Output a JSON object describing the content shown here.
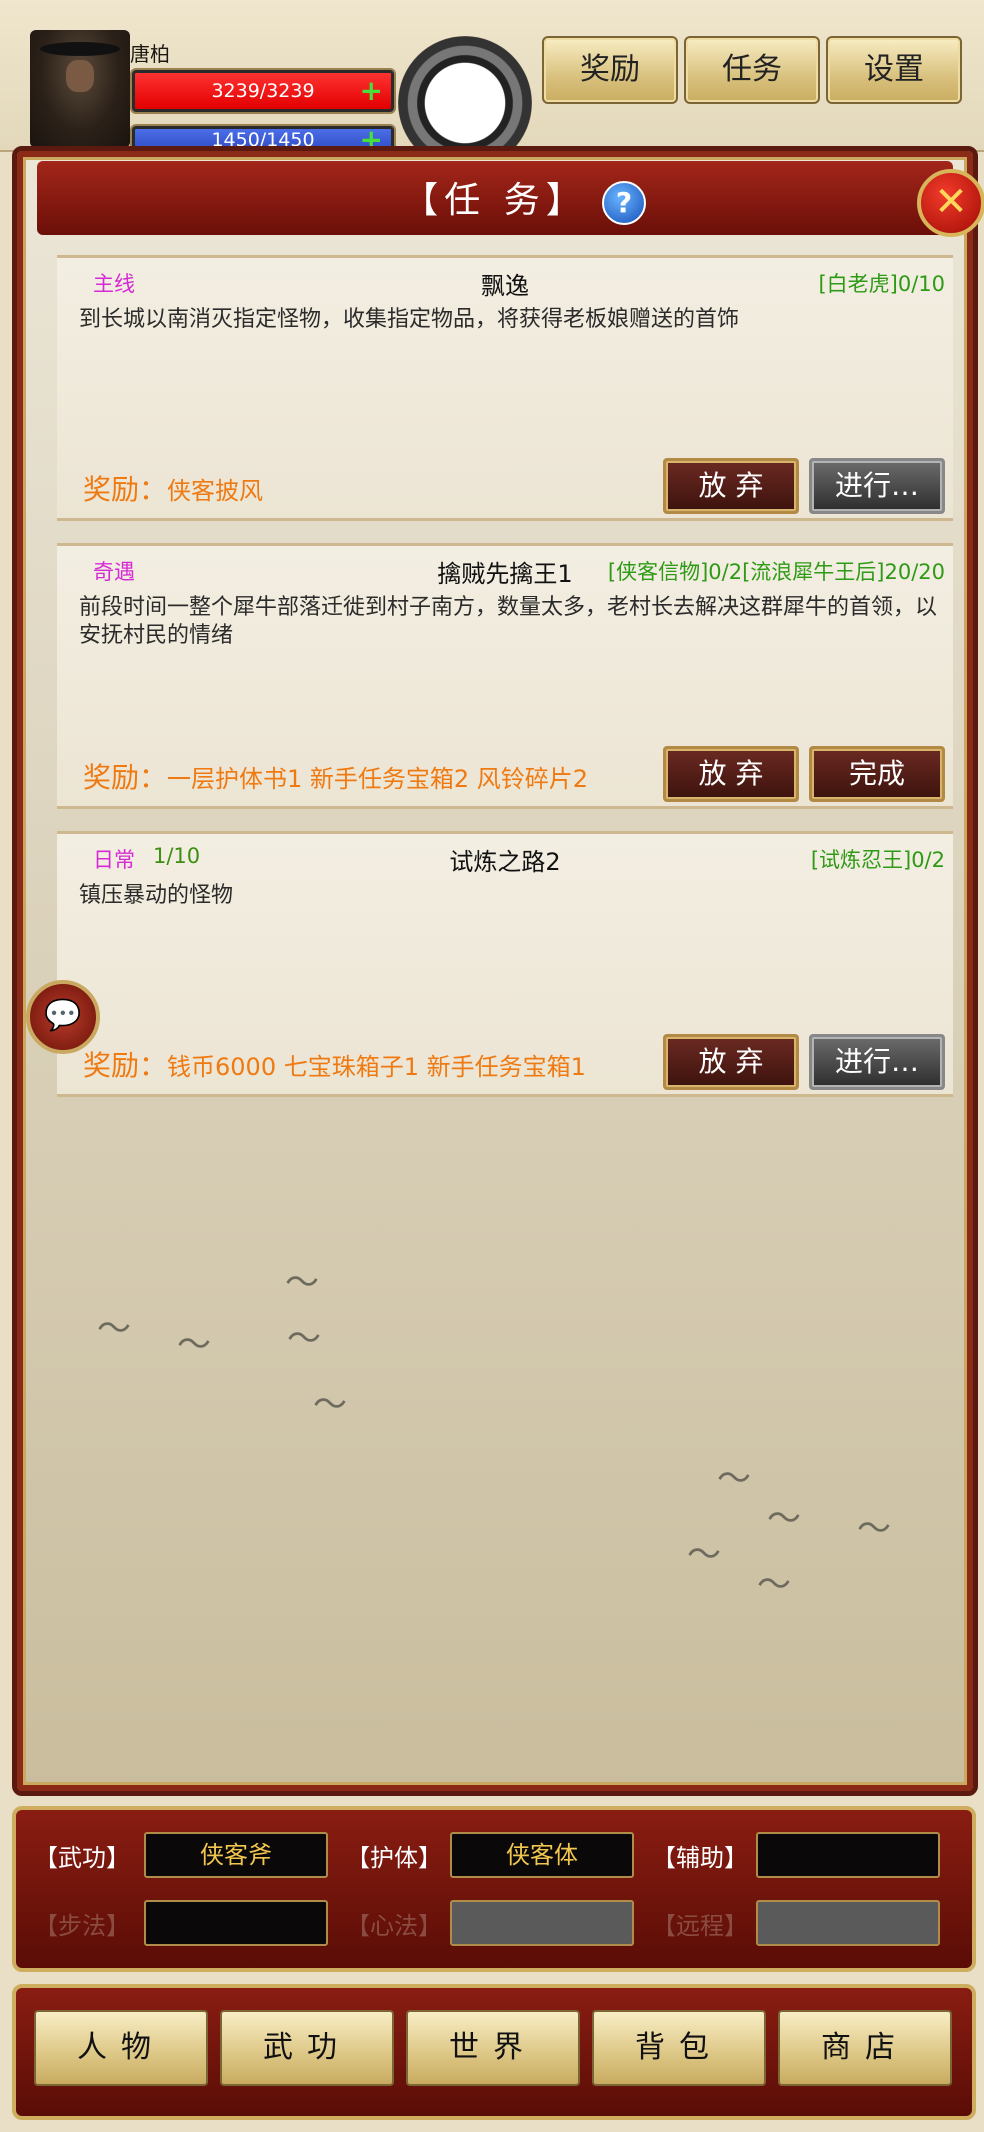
{
  "player": {
    "name": "唐柏",
    "hp": "3239/3239",
    "mp": "1450/1450"
  },
  "top_buttons": {
    "reward": "奖励",
    "task": "任务",
    "settings": "设置"
  },
  "panel": {
    "title": "【任  务】",
    "help": "?",
    "close": "✕"
  },
  "quests": [
    {
      "type": "主线",
      "count": "",
      "name": "飘逸",
      "progress": "[白老虎]0/10",
      "desc": "到长城以南消灭指定怪物，收集指定物品，将获得老板娘赠送的首饰",
      "reward_label": "奖励：",
      "reward": "侠客披风",
      "btn_abandon": "放 弃",
      "btn_action": "进行…",
      "action_state": "progress"
    },
    {
      "type": "奇遇",
      "count": "",
      "name": "擒贼先擒王1",
      "progress": "[侠客信物]0/2[流浪犀牛王后]20/20",
      "desc": "前段时间一整个犀牛部落迁徙到村子南方，数量太多，老村长去解决这群犀牛的首领，以安抚村民的情绪",
      "reward_label": "奖励：",
      "reward": "一层护体书1 新手任务宝箱2 风铃碎片2",
      "btn_abandon": "放 弃",
      "btn_action": "完成",
      "action_state": "complete"
    },
    {
      "type": "日常",
      "count": "1/10",
      "name": "试炼之路2",
      "progress": "[试炼忍王]0/2",
      "desc": "镇压暴动的怪物",
      "reward_label": "奖励：",
      "reward": "钱币6000 七宝珠箱子1 新手任务宝箱1",
      "btn_abandon": "放 弃",
      "btn_action": "进行…",
      "action_state": "progress"
    }
  ],
  "equipment": {
    "weapon_label": "【武功】",
    "weapon": "侠客斧",
    "body_label": "【护体】",
    "body": "侠客体",
    "assist_label": "【辅助】",
    "assist": "",
    "step_label": "【步法】",
    "step": "",
    "heart_label": "【心法】",
    "heart": "",
    "ranged_label": "【远程】",
    "ranged": ""
  },
  "nav": {
    "character": "人物",
    "martial": "武功",
    "world": "世界",
    "bag": "背包",
    "shop": "商店"
  },
  "icons": {
    "help": "help-icon",
    "close": "close-icon",
    "chat": "chat-icon"
  }
}
